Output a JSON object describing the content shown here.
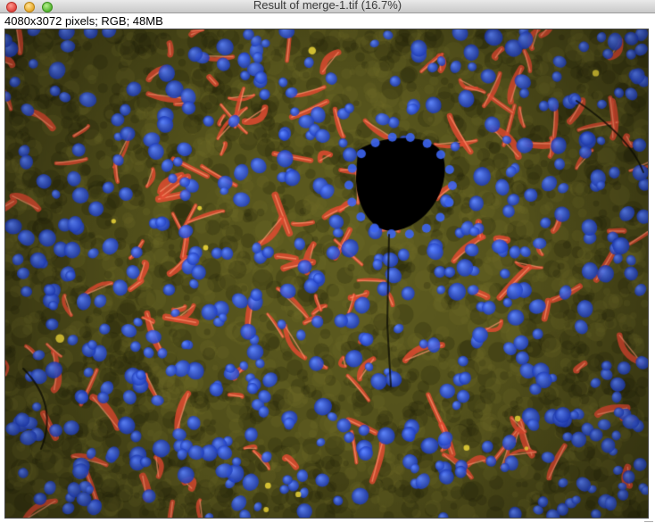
{
  "window": {
    "title": "Result of merge-1.tif (16.7%)",
    "info": "4080x3072 pixels; RGB; 48MB"
  },
  "image": {
    "description_channels": [
      "blue-nuclei",
      "red-vessels",
      "yellow-green-tissue"
    ],
    "colors": {
      "background": "#3a3a10",
      "tissue": "#5a5a1c",
      "nuclei": "#2a55d8",
      "vessels": "#e04a30",
      "vessel_highlight": "#ff8a60",
      "hole": "#000000"
    }
  }
}
